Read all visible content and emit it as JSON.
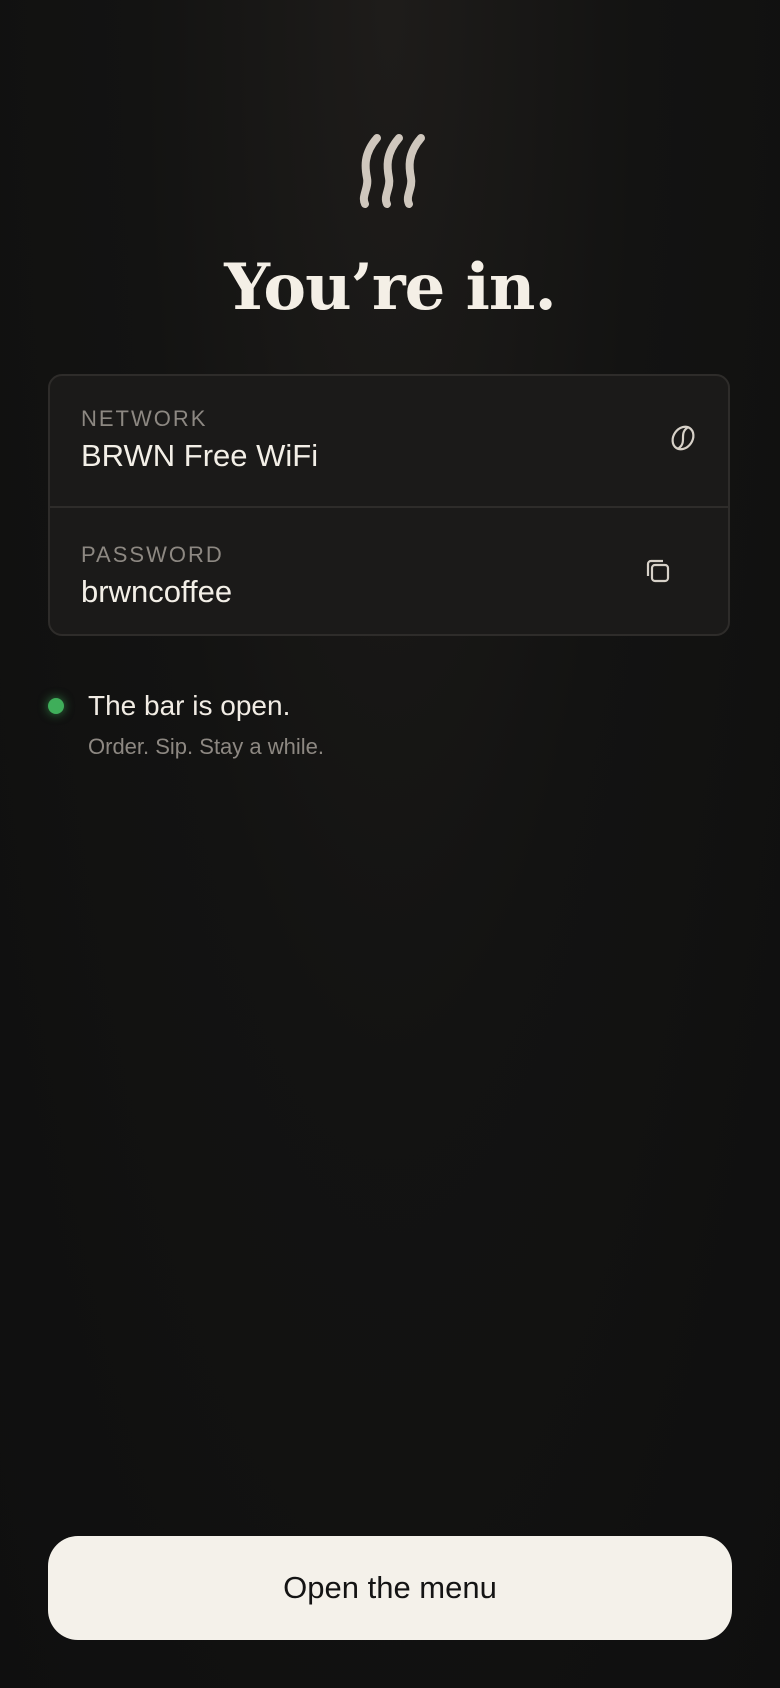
{
  "header": {
    "logo_icon": "steam-icon",
    "title": "You’re in."
  },
  "credentials": {
    "network": {
      "label": "NETWORK",
      "value": "BRWN Free WiFi",
      "icon": "coffee-bean-icon"
    },
    "password": {
      "label": "PASSWORD",
      "value": "brwncoffee",
      "icon": "copy-icon"
    }
  },
  "status": {
    "title": "The bar is open.",
    "subtitle": "Order. Sip. Stay a while.",
    "dot_color": "#3fae5a"
  },
  "cta": {
    "label": "Open the menu"
  },
  "colors": {
    "background": "#121212",
    "card": "#1b1a19",
    "text": "#f3efe7",
    "muted": "#8d8882",
    "button": "#f4f1ea"
  }
}
